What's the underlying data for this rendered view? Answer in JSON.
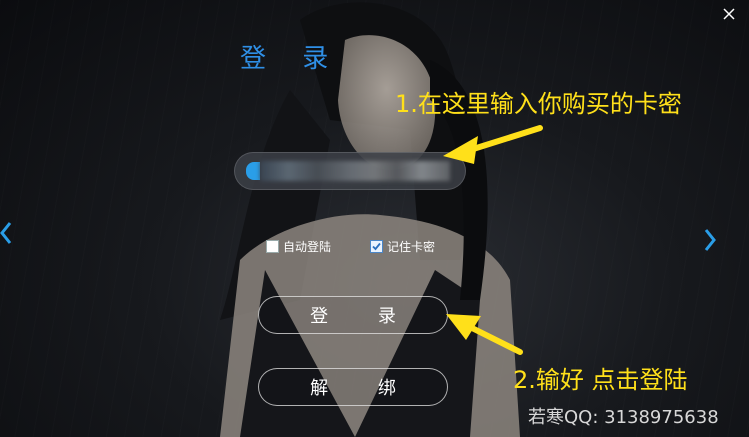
{
  "window": {
    "title": "登 录",
    "close_icon": "close-icon"
  },
  "colors": {
    "accent": "#2a9ee8",
    "title": "#2f8fe6",
    "hint": "#ffe01a",
    "contact": "#d8d8d8"
  },
  "card_key": {
    "value": "",
    "placeholder": ""
  },
  "options": {
    "auto_login": {
      "label": "自动登陆",
      "checked": false
    },
    "remember_key": {
      "label": "记住卡密",
      "checked": true
    }
  },
  "buttons": {
    "login": "登 录",
    "unbind": "解 绑"
  },
  "nav": {
    "prev_icon": "chevron-left-icon",
    "next_icon": "chevron-right-icon"
  },
  "hints": {
    "step1": "1.在这里输入你购买的卡密",
    "step2": "2.输好 点击登陆"
  },
  "footer": {
    "contact": "若寒QQ: 3138975638"
  }
}
